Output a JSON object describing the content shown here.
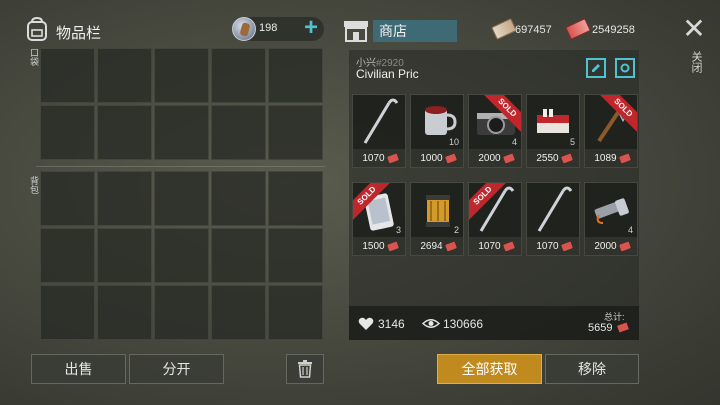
{
  "inventory": {
    "title": "物品栏",
    "currency_value": "198",
    "pocket_label": "口袋",
    "backpack_label": "背包",
    "buttons": {
      "sell": "出售",
      "split": "分开"
    }
  },
  "shop": {
    "title": "商店",
    "currency_1": "697457",
    "currency_2": "2549258",
    "close_label": "关闭",
    "seller_name": "小兴",
    "seller_id": "#2920",
    "shop_name": "Civilian Pric",
    "items": [
      {
        "icon": "crowbar-icon",
        "price": "1070",
        "count": "",
        "sold": false
      },
      {
        "icon": "mug-icon",
        "price": "1000",
        "count": "10",
        "sold": false
      },
      {
        "icon": "camera-icon",
        "price": "2000",
        "count": "4",
        "sold": true
      },
      {
        "icon": "cigarettes-icon",
        "price": "2550",
        "count": "5",
        "sold": false
      },
      {
        "icon": "hatchet-icon",
        "price": "1089",
        "count": "",
        "sold": true
      },
      {
        "icon": "phone-icon",
        "price": "1500",
        "count": "3",
        "sold": true
      },
      {
        "icon": "filter-icon",
        "price": "2694",
        "count": "2",
        "sold": false
      },
      {
        "icon": "crowbar-icon",
        "price": "1070",
        "count": "",
        "sold": true
      },
      {
        "icon": "crowbar-icon",
        "price": "1070",
        "count": "",
        "sold": false
      },
      {
        "icon": "flashlight-icon",
        "price": "2000",
        "count": "4",
        "sold": false
      }
    ],
    "sold_label": "SOLD",
    "likes": "3146",
    "views": "130666",
    "total_label": "总计:",
    "total_value": "5659",
    "buttons": {
      "get_all": "全部获取",
      "remove": "移除"
    }
  },
  "colors": {
    "accent": "#4fc3d4",
    "sold": "#c0272d",
    "primary_button": "#c08a1e"
  }
}
